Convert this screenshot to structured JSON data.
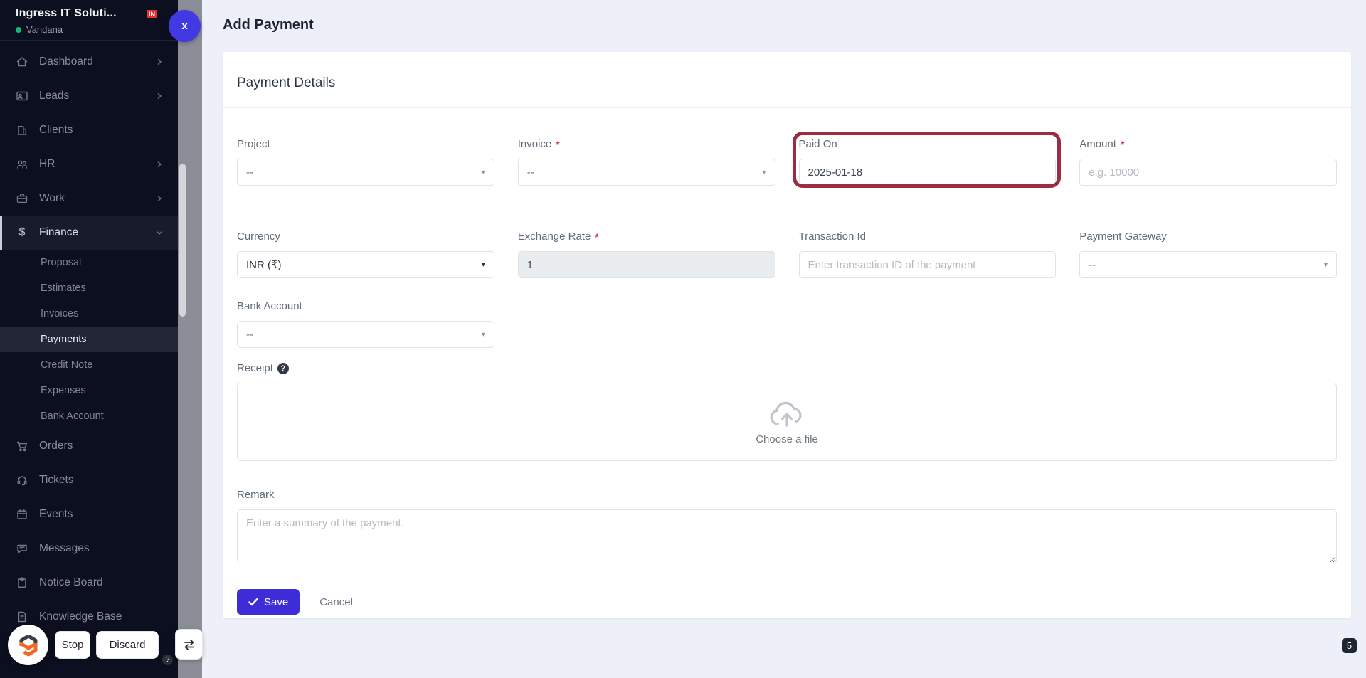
{
  "sidebar": {
    "company": "Ingress IT Soluti...",
    "user": "Vandana",
    "in_badge": "IN",
    "close_label": "x",
    "items": [
      {
        "label": "Dashboard",
        "icon": "home-icon",
        "chevron": "right"
      },
      {
        "label": "Leads",
        "icon": "id-card-icon",
        "chevron": "right"
      },
      {
        "label": "Clients",
        "icon": "building-icon",
        "chevron": ""
      },
      {
        "label": "HR",
        "icon": "users-icon",
        "chevron": "right"
      },
      {
        "label": "Work",
        "icon": "briefcase-icon",
        "chevron": "right"
      },
      {
        "label": "Finance",
        "icon": "dollar-icon",
        "chevron": "down",
        "active": true
      },
      {
        "label": "Orders",
        "icon": "cart-icon",
        "chevron": ""
      },
      {
        "label": "Tickets",
        "icon": "headset-icon",
        "chevron": ""
      },
      {
        "label": "Events",
        "icon": "calendar-icon",
        "chevron": ""
      },
      {
        "label": "Messages",
        "icon": "chat-icon",
        "chevron": ""
      },
      {
        "label": "Notice Board",
        "icon": "clipboard-icon",
        "chevron": ""
      },
      {
        "label": "Knowledge Base",
        "icon": "document-icon",
        "chevron": ""
      }
    ],
    "finance_sub": [
      {
        "label": "Proposal"
      },
      {
        "label": "Estimates"
      },
      {
        "label": "Invoices"
      },
      {
        "label": "Payments",
        "active": true
      },
      {
        "label": "Credit Note"
      },
      {
        "label": "Expenses"
      },
      {
        "label": "Bank Account"
      }
    ]
  },
  "header": {
    "title": "Add Payment"
  },
  "card": {
    "title": "Payment Details"
  },
  "form": {
    "project": {
      "label": "Project",
      "value": "--"
    },
    "invoice": {
      "label": "Invoice",
      "required": "*",
      "value": "--"
    },
    "paid_on": {
      "label": "Paid On",
      "value": "2025-01-18"
    },
    "amount": {
      "label": "Amount",
      "required": "*",
      "placeholder": "e.g. 10000"
    },
    "currency": {
      "label": "Currency",
      "value": "INR (₹)"
    },
    "exchange_rate": {
      "label": "Exchange Rate",
      "required": "*",
      "value": "1"
    },
    "transaction_id": {
      "label": "Transaction Id",
      "placeholder": "Enter transaction ID of the payment"
    },
    "payment_gateway": {
      "label": "Payment Gateway",
      "value": "--"
    },
    "bank_account": {
      "label": "Bank Account",
      "value": "--"
    },
    "receipt": {
      "label": "Receipt",
      "help": "?",
      "upload_text": "Choose a file"
    },
    "remark": {
      "label": "Remark",
      "placeholder": "Enter a summary of the payment."
    },
    "save_label": "Save",
    "cancel_label": "Cancel"
  },
  "overlay": {
    "stop_label": "Stop",
    "discard_label": "Discard",
    "help_badge": "?",
    "count_badge": "5"
  },
  "colors": {
    "accent_indigo": "#3e2dd6",
    "close_button_blue": "#4339e2",
    "highlight_ring_red": "#9b2c42",
    "required_red": "#e0314b",
    "sidebar_bg": "#0c0f20",
    "page_bg": "#edf0f8",
    "online_green": "#17b877",
    "in_badge_red": "#e03131"
  }
}
